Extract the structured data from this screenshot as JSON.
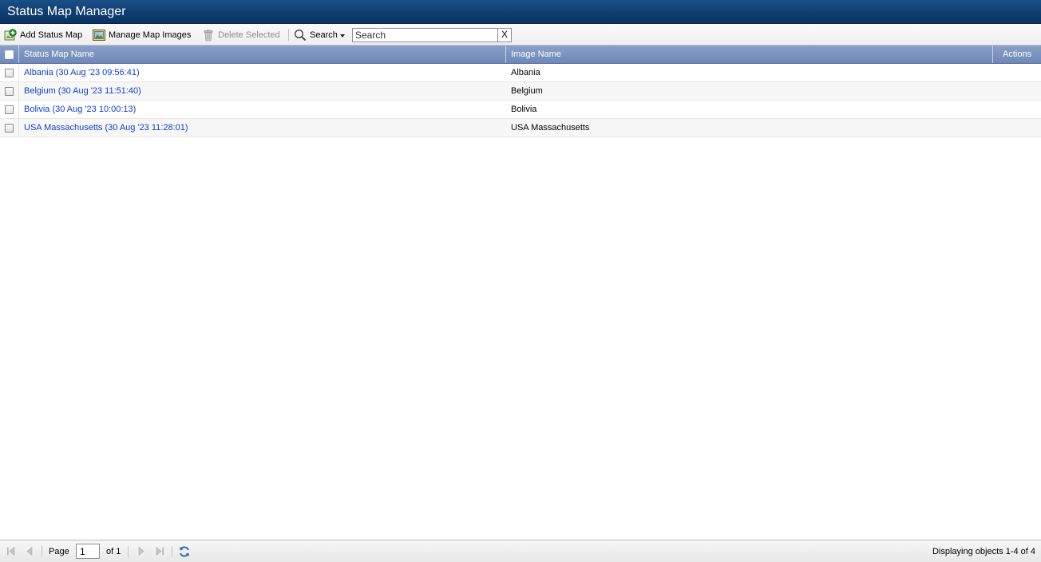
{
  "window": {
    "title": "Status Map Manager"
  },
  "toolbar": {
    "add_label": "Add Status Map",
    "manage_label": "Manage Map Images",
    "delete_label": "Delete Selected",
    "search_label": "Search",
    "search_placeholder": "Search",
    "search_value": "",
    "clear_label": "X"
  },
  "grid": {
    "columns": {
      "name": "Status Map Name",
      "image": "Image Name",
      "actions": "Actions"
    },
    "rows": [
      {
        "name": "Albania (30 Aug '23 09:56:41)",
        "image": "Albania"
      },
      {
        "name": "Belgium (30 Aug '23 11:51:40)",
        "image": "Belgium"
      },
      {
        "name": "Bolivia (30 Aug '23 10:00:13)",
        "image": "Bolivia"
      },
      {
        "name": "USA Massachusetts (30 Aug '23 11:28:01)",
        "image": "USA Massachusetts"
      }
    ]
  },
  "paging": {
    "page_label": "Page",
    "page_value": "1",
    "of_label": "of 1",
    "status": "Displaying objects 1-4 of 4"
  },
  "colors": {
    "title_bar": "#0f3d70",
    "header": "#7b93c0",
    "link": "#0d3fcf"
  },
  "icons": {
    "add": "add-map-icon",
    "manage": "map-images-icon",
    "delete": "trash-icon",
    "search": "magnifier-icon",
    "first": "first-page-icon",
    "prev": "prev-page-icon",
    "next": "next-page-icon",
    "last": "last-page-icon",
    "refresh": "refresh-icon"
  }
}
